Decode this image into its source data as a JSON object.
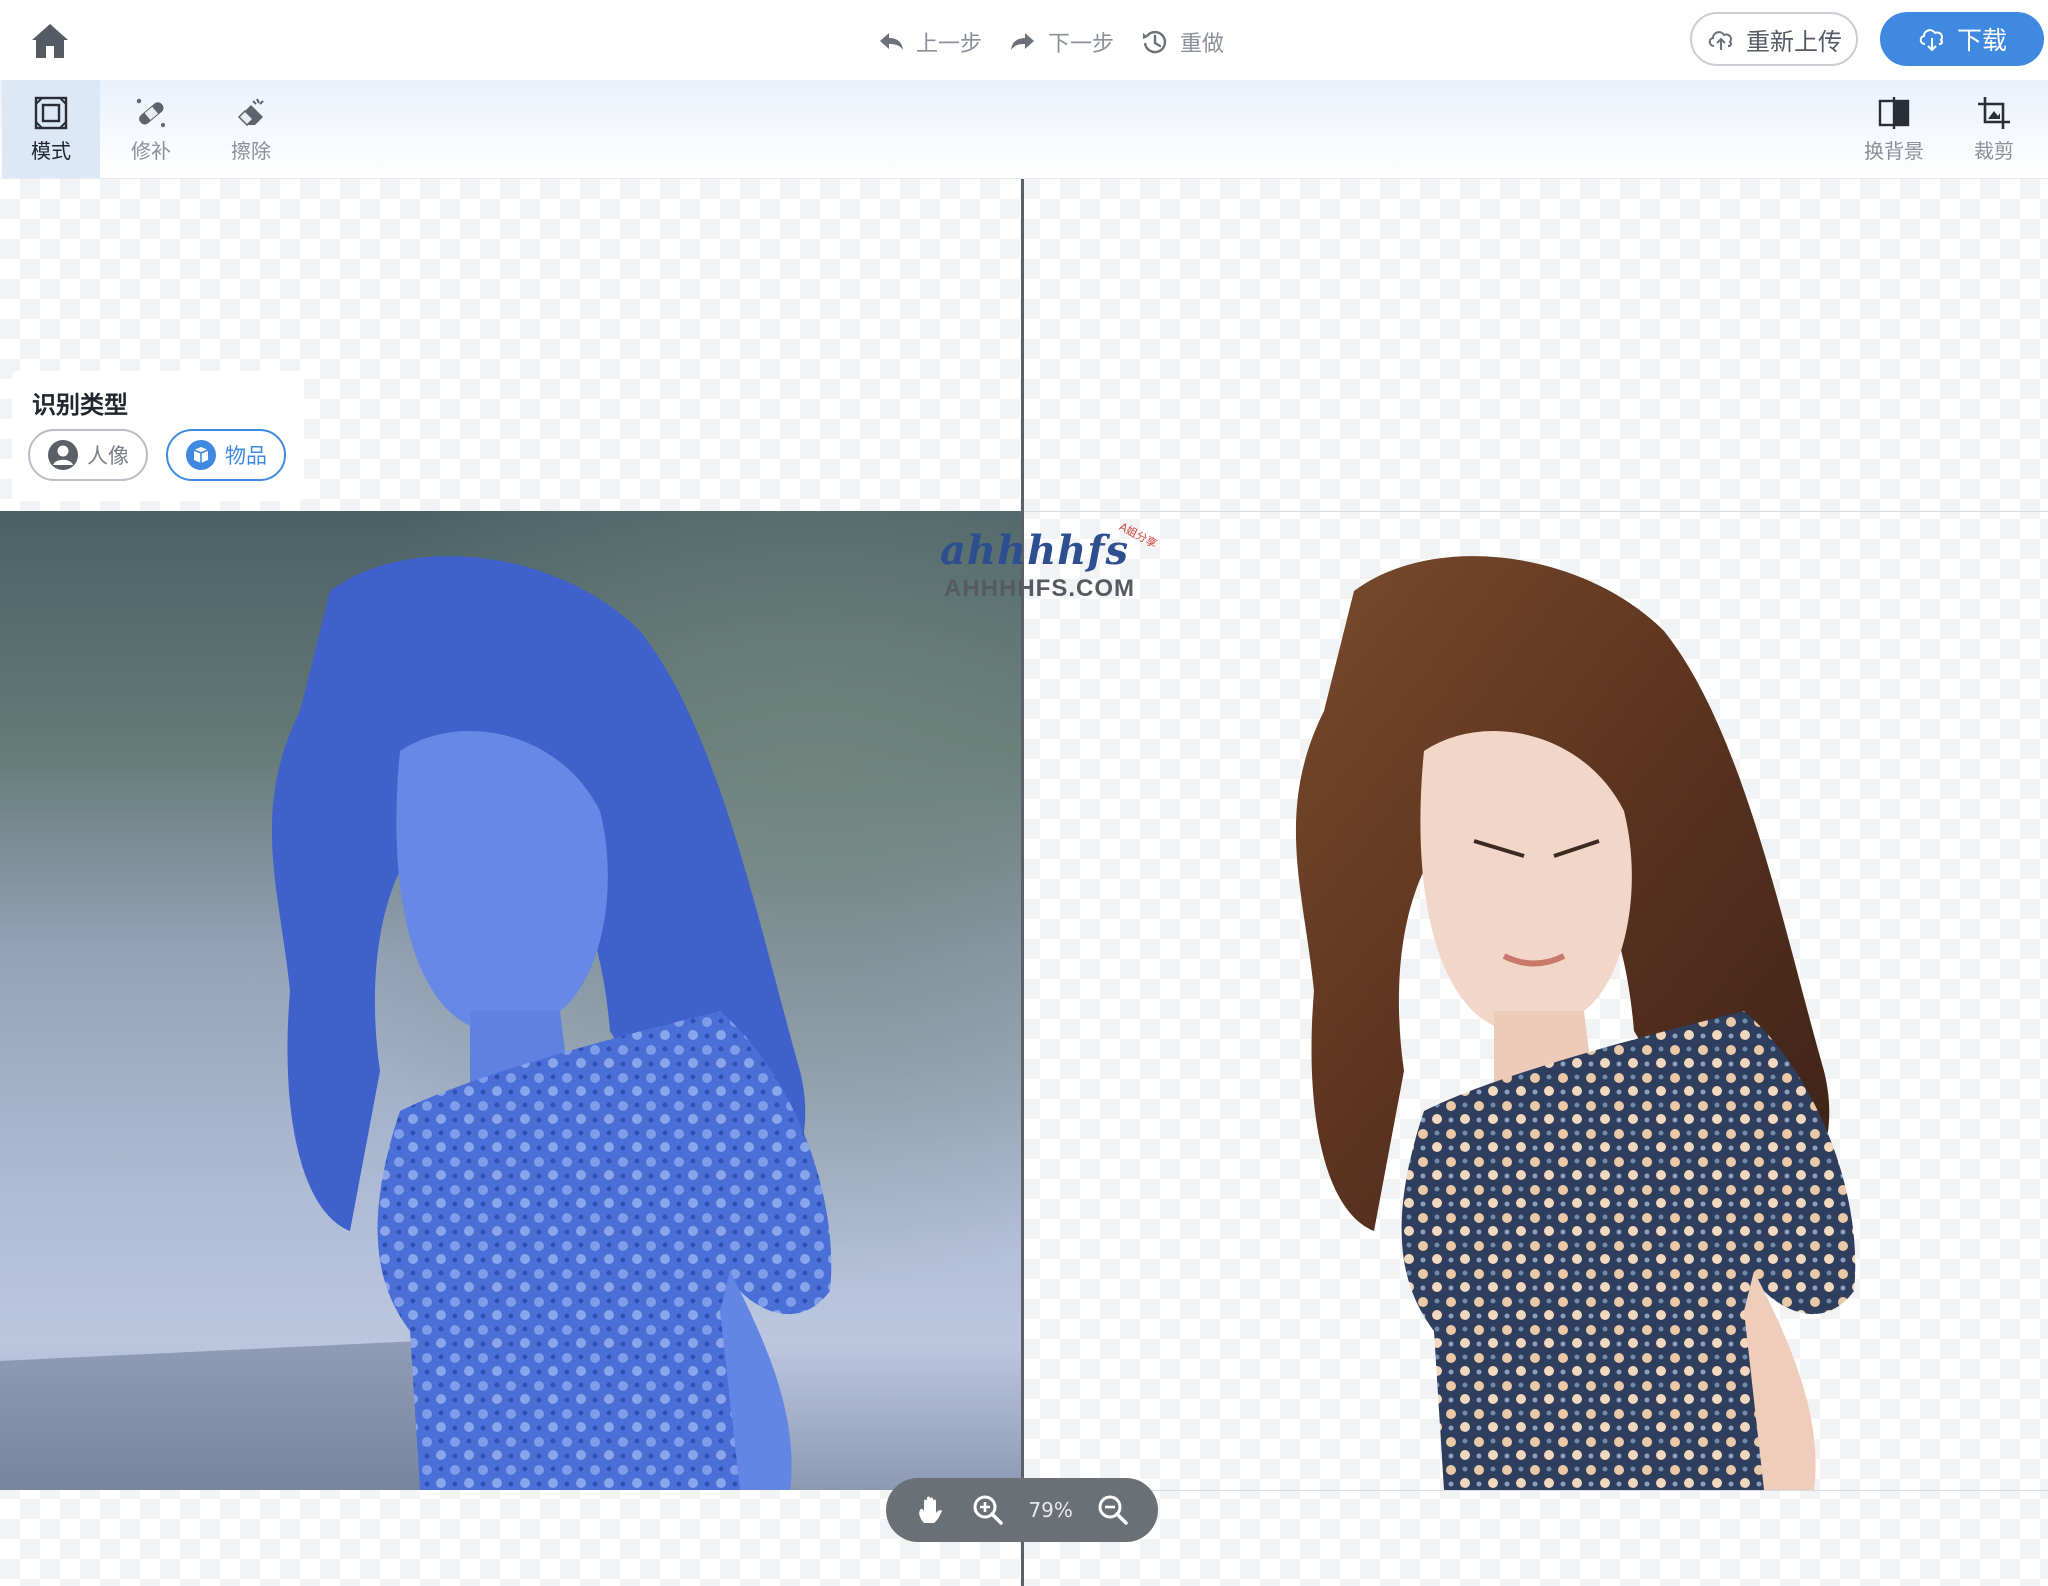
{
  "header": {
    "undo_label": "上一步",
    "redo_label": "下一步",
    "reset_label": "重做",
    "reupload_label": "重新上传",
    "download_label": "下载"
  },
  "toolbar": {
    "left_tools": [
      {
        "label": "模式",
        "icon": "mode-icon",
        "active": true
      },
      {
        "label": "修补",
        "icon": "bandage-icon",
        "active": false
      },
      {
        "label": "擦除",
        "icon": "eraser-icon",
        "active": false
      }
    ],
    "right_tools": [
      {
        "label": "换背景",
        "icon": "change-background-icon"
      },
      {
        "label": "裁剪",
        "icon": "crop-icon"
      }
    ]
  },
  "recognition": {
    "title": "识别类型",
    "options": [
      {
        "label": "人像",
        "icon": "person-icon",
        "selected": false
      },
      {
        "label": "物品",
        "icon": "object-icon",
        "selected": true
      }
    ]
  },
  "watermark": {
    "logo_text": "ahhhhfs",
    "tag_text": "A姐分享",
    "url_text": "AHHHHFS.COM"
  },
  "zoom": {
    "level_label": "79%"
  },
  "colors": {
    "accent": "#3f8ae0",
    "mask_overlay": "#3e6fe0",
    "divider": "#5c6068"
  }
}
